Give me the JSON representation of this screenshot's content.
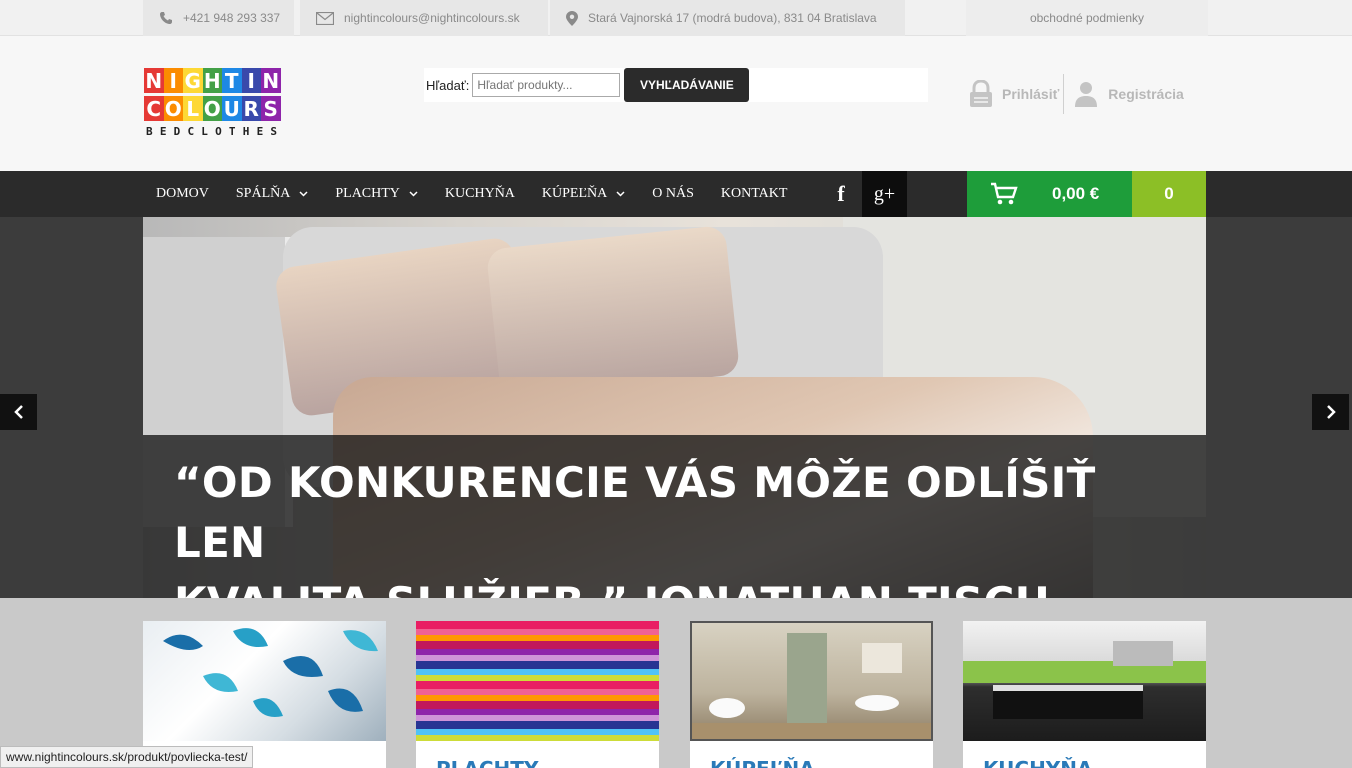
{
  "topbar": {
    "phone": "+421 948 293 337",
    "email": "nightincolours@nightincolours.sk",
    "address": "Stará Vajnorská 17 (modrá budova), 831 04 Bratislava",
    "terms": "obchodné podmienky"
  },
  "logo": {
    "row1": [
      "N",
      "I",
      "G",
      "H",
      "T",
      "I",
      "N"
    ],
    "row2": [
      "C",
      "O",
      "L",
      "O",
      "U",
      "R",
      "S"
    ],
    "subtitle": "BEDCLOTHES",
    "colors": [
      "#e53935",
      "#fb8c00",
      "#fdd835",
      "#43a047",
      "#1e88e5",
      "#3949ab",
      "#8e24aa"
    ]
  },
  "search": {
    "label": "Hľadať:",
    "placeholder": "Hľadať produkty...",
    "button": "VYHĽADÁVANIE"
  },
  "auth": {
    "login": "Prihlásiť",
    "register": "Registrácia"
  },
  "nav": {
    "items": [
      {
        "label": "DOMOV"
      },
      {
        "label": "SPÁLŇA"
      },
      {
        "label": "PLACHTY"
      },
      {
        "label": "KUCHYŇA"
      },
      {
        "label": "KÚPEĽŇA"
      },
      {
        "label": "O NÁS"
      },
      {
        "label": "KONTAKT"
      }
    ],
    "facebook": "f",
    "googleplus": "g+"
  },
  "cart": {
    "amount": "0,00 €",
    "count": "0"
  },
  "hero": {
    "quote_line1": "“OD KONKURENCIE VÁS MÔŽE ODLÍŠIŤ LEN",
    "quote_line2": "KVALITA SLUŽIEB.” JONATHAN TISCH"
  },
  "categories": [
    {
      "title": ""
    },
    {
      "title": "PLACHTY"
    },
    {
      "title": "KÚPEĽŇA"
    },
    {
      "title": "KUCHYŇA"
    }
  ],
  "status_url": "www.nightincolours.sk/produkt/povliecka-test/"
}
